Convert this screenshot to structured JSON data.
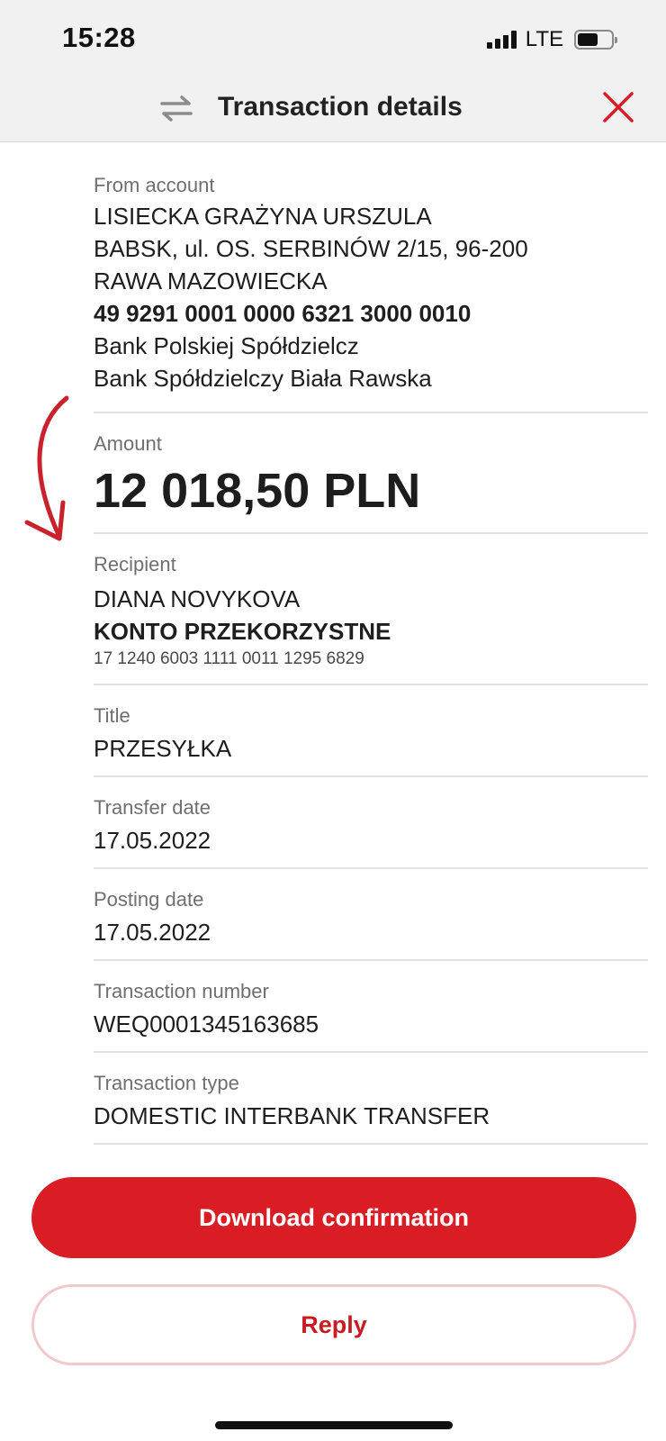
{
  "status_bar": {
    "time": "15:28",
    "network": "LTE"
  },
  "header": {
    "title": "Transaction details"
  },
  "from_account": {
    "label": "From account",
    "name": "LISIECKA GRAŻYNA URSZULA",
    "address_line1": "BABSK, ul. OS. SERBINÓW 2/15, 96-200",
    "address_line2": "RAWA MAZOWIECKA",
    "account_number": "49 9291 0001 0000 6321 3000 0010",
    "bank_line1": "Bank Polskiej Spółdzielcz",
    "bank_line2": "Bank Spółdzielczy Biała Rawska"
  },
  "amount": {
    "label": "Amount",
    "value": "12 018,50 PLN"
  },
  "recipient": {
    "label": "Recipient",
    "name": "DIANA NOVYKOVA",
    "account_name": "KONTO PRZEKORZYSTNE",
    "account_number": "17 1240 6003 1111 0011 1295 6829"
  },
  "title_field": {
    "label": "Title",
    "value": "PRZESYŁKA"
  },
  "transfer_date": {
    "label": "Transfer date",
    "value": "17.05.2022"
  },
  "posting_date": {
    "label": "Posting date",
    "value": "17.05.2022"
  },
  "transaction_number": {
    "label": "Transaction number",
    "value": "WEQ0001345163685"
  },
  "transaction_type": {
    "label": "Transaction type",
    "value": "DOMESTIC INTERBANK TRANSFER"
  },
  "buttons": {
    "download": "Download confirmation",
    "reply": "Reply"
  },
  "colors": {
    "accent": "#da1d24",
    "secondary_border": "#f1c9cb",
    "header_bg": "#f1f1f1"
  },
  "icons": {
    "swap": "swap-arrows-icon",
    "close": "close-icon",
    "annotation": "red-arrow-annotation"
  }
}
